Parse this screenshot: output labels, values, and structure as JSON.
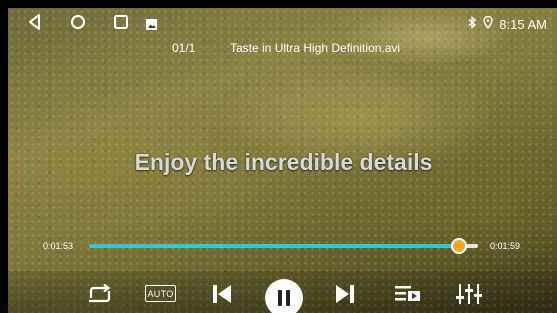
{
  "status_bar": {
    "nav_icons": [
      "back-icon",
      "home-icon",
      "recents-icon",
      "gallery-notification-icon"
    ],
    "status_icons": [
      "bluetooth-icon",
      "location-icon"
    ],
    "time": "8:15 AM"
  },
  "player": {
    "counter": "01/1",
    "file_name": "Taste in Ultra High Definition.avi",
    "caption": "Enjoy the incredible details",
    "elapsed": "0:01:53",
    "duration": "0:01:59",
    "progress_fraction": 0.95,
    "accent_color": "#2ec8d6",
    "thumb_color": "#f5a623"
  },
  "controls": {
    "repeat_icon": "repeat-icon",
    "auto_label": "AUTO",
    "previous_icon": "skip-previous-icon",
    "pause_icon": "pause-icon",
    "next_icon": "skip-next-icon",
    "playlist_icon": "playlist-icon",
    "equalizer_icon": "equalizer-icon"
  }
}
